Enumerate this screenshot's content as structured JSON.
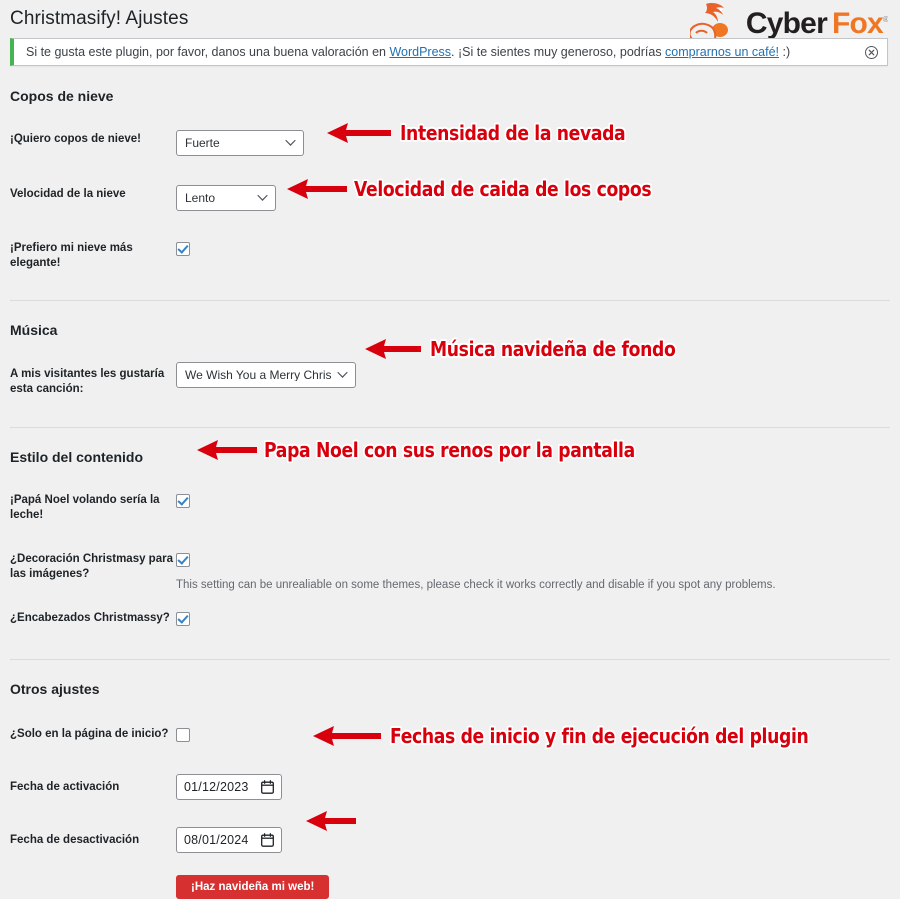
{
  "header": {
    "title": "Christmasify! Ajustes",
    "logo": {
      "word1": "Cyber",
      "word2": "Fox",
      "trademark": "®"
    }
  },
  "notice": {
    "text_part1": "Si te gusta este plugin, por favor, danos una buena valoración en ",
    "link1": "WordPress",
    "text_part2": ". ¡Si te sientes muy generoso, podrías ",
    "link2": "comprarnos un café!",
    "text_part3": " :)",
    "dismiss_label": "×"
  },
  "sections": {
    "snowflakes": {
      "title": "Copos de nieve",
      "intensity": {
        "label": "¡Quiero copos de nieve!",
        "value": "Fuerte",
        "options": [
          "Fuerte"
        ]
      },
      "speed": {
        "label": "Velocidad de la nieve",
        "value": "Lento",
        "options": [
          "Lento"
        ]
      },
      "elegant": {
        "label": "¡Prefiero mi nieve más elegante!",
        "checked": true
      }
    },
    "music": {
      "title": "Música",
      "song": {
        "label": "A mis visitantes les gustaría esta canción:",
        "value": "We Wish You a Merry Christmas",
        "options": [
          "We Wish You a Merry Christmas"
        ]
      }
    },
    "content_style": {
      "title": "Estilo del contenido",
      "santa": {
        "label": "¡Papá Noel volando sería la leche!",
        "checked": true
      },
      "images": {
        "label": "¿Decoración Christmasy para las imágenes?",
        "checked": true,
        "helper": "This setting can be unrealiable on some themes, please check it works correctly and disable if you spot any problems."
      },
      "headings": {
        "label": "¿Encabezados Christmassy?",
        "checked": true
      }
    },
    "other": {
      "title": "Otros ajustes",
      "home_only": {
        "label": "¿Solo en la página de inicio?",
        "checked": false
      },
      "activation_date": {
        "label": "Fecha de activación",
        "value": "01/12/2023"
      },
      "deactivation_date": {
        "label": "Fecha de desactivación",
        "value": "08/01/2024"
      },
      "submit": {
        "label": "¡Haz navideña mi web!"
      }
    }
  },
  "annotations": [
    {
      "text": "Intensidad de la nevada"
    },
    {
      "text": "Velocidad de caida de los copos"
    },
    {
      "text": "Música navideña de fondo"
    },
    {
      "text": "Papa Noel con sus renos por la pantalla"
    },
    {
      "text": "Fechas de inicio y fin de ejecución del plugin"
    }
  ],
  "colors": {
    "accent_red": "#d9000d",
    "button_red": "#d63031",
    "brand_orange": "#ef7622",
    "link_blue": "#2271b1",
    "notice_green": "#46b450",
    "page_bg": "#f0f0f1"
  }
}
